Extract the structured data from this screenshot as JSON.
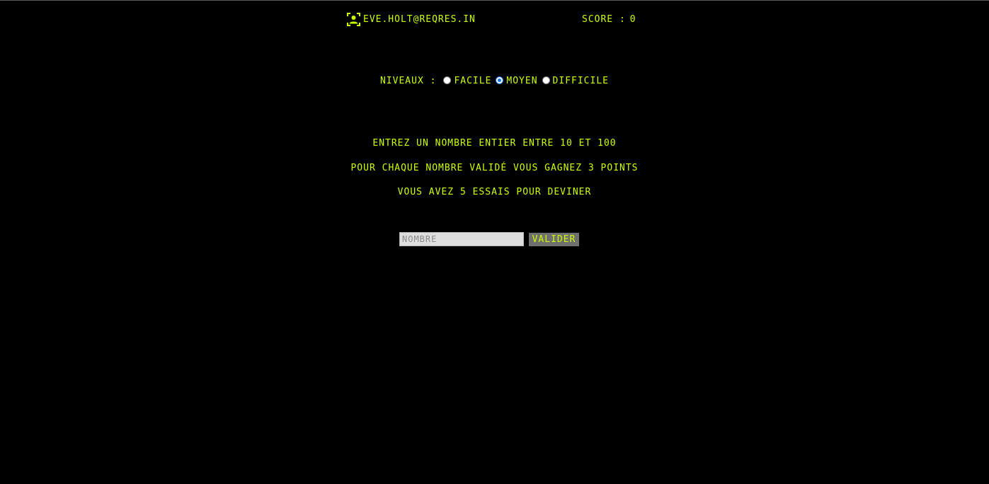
{
  "header": {
    "user_icon": "user-icon",
    "email": "eve.holt@reqres.in",
    "score_label": "Score :",
    "score_value": "0"
  },
  "levels": {
    "label": "Niveaux :",
    "options": [
      {
        "label": "Facile",
        "checked": false
      },
      {
        "label": "Moyen",
        "checked": true
      },
      {
        "label": "Difficile",
        "checked": false
      }
    ]
  },
  "instructions": {
    "line1": "Entrez un nombre entier entre 10 et 100",
    "line2": "Pour chaque nombre validé vous gagnez 3 points",
    "line3": "Vous avez 5 essais pour deviner"
  },
  "form": {
    "input_placeholder": "Nombre",
    "input_value": "",
    "submit_label": "Valider"
  },
  "colors": {
    "background": "#000000",
    "accent": "#ccff00",
    "button_bg": "#6f6f6f",
    "input_bg": "#dedede",
    "radio_selected": "#1a73e8"
  }
}
